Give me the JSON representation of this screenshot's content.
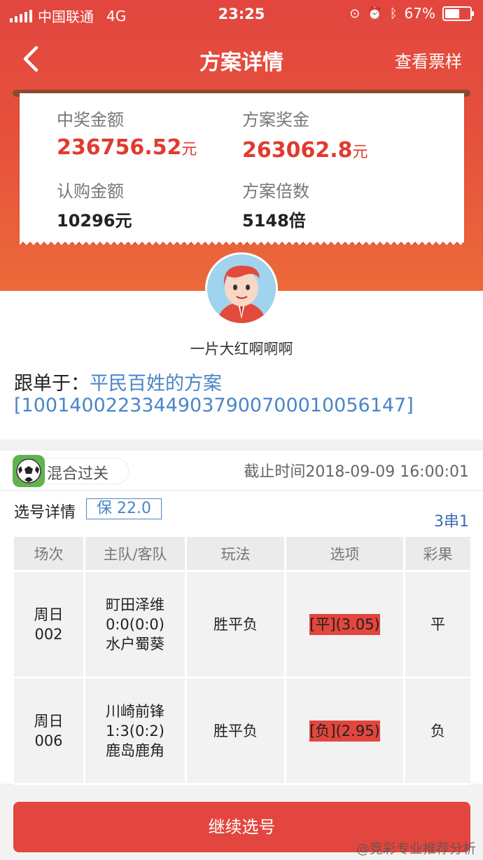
{
  "status_bar": {
    "carrier": "中国联通",
    "network": "4G",
    "time": "23:25",
    "battery": "67%",
    "battery_level": 0.67
  },
  "nav": {
    "title": "方案详情",
    "right_label": "查看票样",
    "back_icon": "chevron-left-icon"
  },
  "ticket": {
    "win_amount_label": "中奖金额",
    "win_amount": "236756.52",
    "win_amount_unit": "元",
    "plan_prize_label": "方案奖金",
    "plan_prize": "263062.8",
    "plan_prize_unit": "元",
    "buy_amount_label": "认购金额",
    "buy_amount": "10296元",
    "multiple_label": "方案倍数",
    "multiple": "5148倍"
  },
  "profile": {
    "username": "一片大红啊啊啊",
    "follow_prefix": "跟单于：",
    "follow_link": "平民百姓的方案[10014002233449037900700010056147]"
  },
  "plan": {
    "type_label": "混合过关",
    "deadline": "截止时间2018-09-09 16:00:01",
    "section_title": "选号详情",
    "bao": "保 22.0",
    "pass_type": "3串1",
    "columns": [
      "场次",
      "主队/客队",
      "玩法",
      "选项",
      "彩果"
    ],
    "rows": [
      {
        "match_day": "周日",
        "match_no": "002",
        "home": "町田泽维",
        "score": "0:0(0:0)",
        "away": "水户蜀葵",
        "play": "胜平负",
        "option_tag": "[平]",
        "option_odds": "(3.05)",
        "result": "平"
      },
      {
        "match_day": "周日",
        "match_no": "006",
        "home": "川崎前锋",
        "score": "1:3(0:2)",
        "away": "鹿岛鹿角",
        "play": "胜平负",
        "option_tag": "[负]",
        "option_odds": "(2.95)",
        "result": "负"
      }
    ]
  },
  "footer": {
    "button_label": "继续选号"
  },
  "watermark": "@竞彩专业推荐分析",
  "colors": {
    "primary_red": "#e2463e",
    "link_blue": "#4a85c8"
  }
}
